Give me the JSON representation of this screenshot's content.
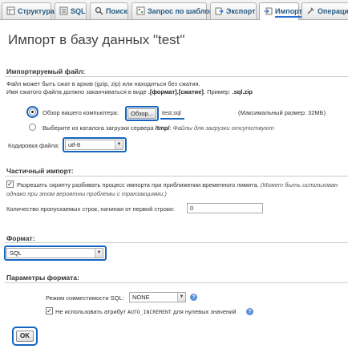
{
  "tabs": [
    {
      "label": "Структура",
      "icon": "structure-icon"
    },
    {
      "label": "SQL",
      "icon": "sql-icon"
    },
    {
      "label": "Поиск",
      "icon": "search-icon"
    },
    {
      "label": "Запрос по шаблону",
      "icon": "query-icon"
    },
    {
      "label": "Экспорт",
      "icon": "export-icon"
    },
    {
      "label": "Импорт",
      "icon": "import-icon"
    },
    {
      "label": "Операции",
      "icon": "operations-icon"
    }
  ],
  "page_title": "Импорт в базу данных \"test\"",
  "file_section": {
    "title": "Импортируемый файл:",
    "note_line1": "Файл может быть сжат в архив (gzip, zip) или находиться без сжатия.",
    "note_line2_prefix": "Имя сжатого файла должно заканчиваться в виде",
    "note_line2_format": ".[формат].[сжатие]",
    "note_line2_example_label": ". Пример:",
    "note_line2_example": ".sql.zip",
    "browse_label": "Обзор вашего компьютера:",
    "browse_button": "Обзор...",
    "file_name": "test.sql",
    "max_size": "(Максимальный размер: 32МБ)",
    "server_label": "Выберите из каталога загрузки сервера",
    "server_path": "/tmp/",
    "server_suffix": ":",
    "server_note": "Файлы для загрузки отсутствуют",
    "encoding_label": "Кодировка файла:",
    "encoding_value": "utf-8"
  },
  "partial_section": {
    "title": "Частичный импорт:",
    "allow_interrupt_line1": "Разрешить скрипту разбивать процесс импорта при приближении временного лимита.",
    "allow_interrupt_line1_italic": "(Может быть использован",
    "allow_interrupt_line2": "однако при этом вероятны проблемы с транзакциями.)",
    "skip_label": "Количество пропускаемых строк, начиная от первой строки:",
    "skip_value": "0"
  },
  "format_section": {
    "title": "Формат:",
    "format_value": "SQL"
  },
  "params_section": {
    "title": "Параметры формата:",
    "compat_label": "Режим совместимости SQL:",
    "compat_value": "NONE",
    "auto_inc_prefix": "Не использовать атрибут",
    "auto_inc_code": "AUTO_INCREMENT",
    "auto_inc_suffix": "для нулевых значений"
  },
  "ok_label": "OK",
  "colors": {
    "highlight": "#1565c0",
    "tab_text": "#235a81"
  }
}
